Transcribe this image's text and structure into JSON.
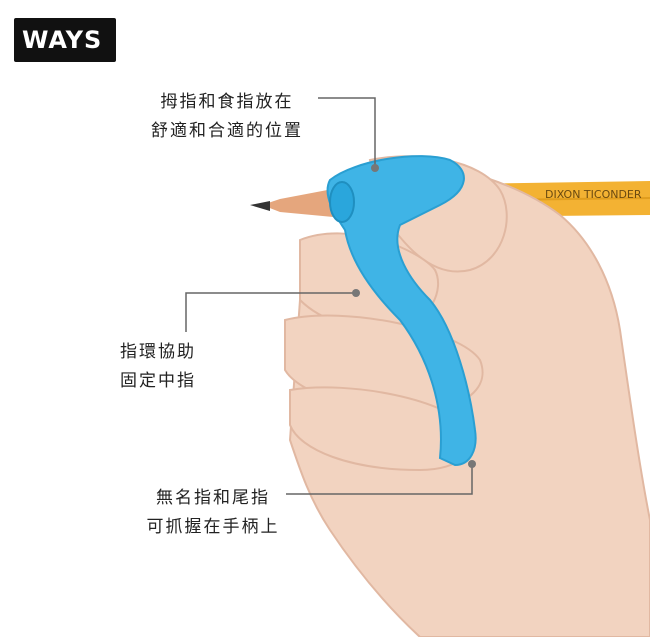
{
  "brand": {
    "logo_text": "WAYS"
  },
  "callouts": [
    {
      "line1": "拇指和食指放在",
      "line2": "舒適和合適的位置"
    },
    {
      "line1": "指環協助",
      "line2": "固定中指"
    },
    {
      "line1": "無名指和尾指",
      "line2": "可抓握在手柄上"
    }
  ],
  "pencil": {
    "print_text": "DIXON  TICONDER"
  },
  "colors": {
    "grip_blue": "#3fb4e6",
    "pencil_yellow": "#f3b233",
    "skin": "#f2d3c0",
    "logo_bg": "#111111"
  }
}
